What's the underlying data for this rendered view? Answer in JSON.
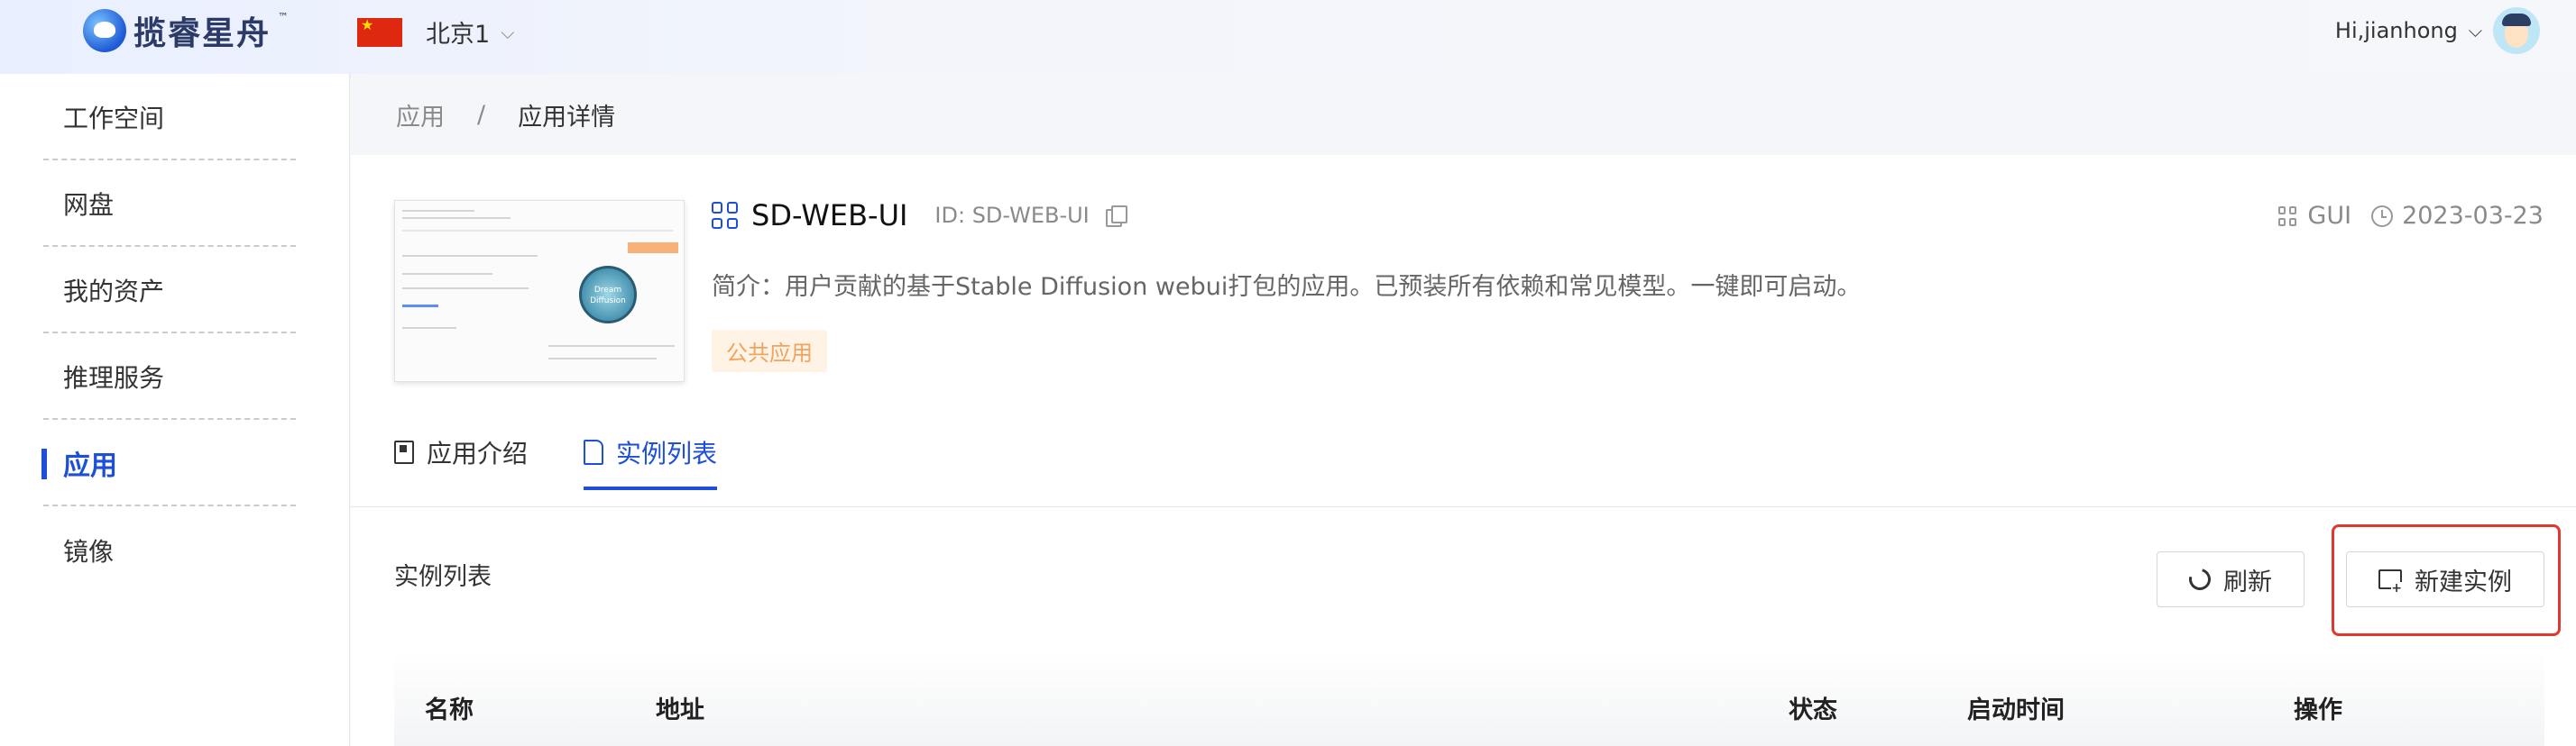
{
  "header": {
    "brand": "揽睿星舟",
    "trademark": "™",
    "region_name": "北京1",
    "user_greeting": "Hi,jianhong"
  },
  "sidebar": {
    "items": [
      {
        "label": "工作空间"
      },
      {
        "label": "网盘"
      },
      {
        "label": "我的资产"
      },
      {
        "label": "推理服务"
      },
      {
        "label": "应用",
        "active": true
      },
      {
        "label": "镜像"
      }
    ]
  },
  "breadcrumb": {
    "parent": "应用",
    "separator": "/",
    "current": "应用详情"
  },
  "app": {
    "name": "SD-WEB-UI",
    "id_text": "ID: SD-WEB-UI",
    "type": "GUI",
    "date": "2023-03-23",
    "description": "简介：用户贡献的基于Stable Diffusion webui打包的应用。已预装所有依赖和常见模型。一键即可启动。",
    "tag": "公共应用",
    "thumbnail_text": "Dream Diffusion"
  },
  "tabs": [
    {
      "label": "应用介绍",
      "active": false
    },
    {
      "label": "实例列表",
      "active": true
    }
  ],
  "instances": {
    "section_title": "实例列表",
    "refresh_label": "刷新",
    "new_label": "新建实例",
    "columns": [
      "名称",
      "地址",
      "状态",
      "启动时间",
      "操作"
    ]
  },
  "colors": {
    "accent": "#1d4fd8",
    "tag_text": "#f0a45e",
    "tag_bg": "#fff3e6",
    "highlight": "#e0382f"
  }
}
